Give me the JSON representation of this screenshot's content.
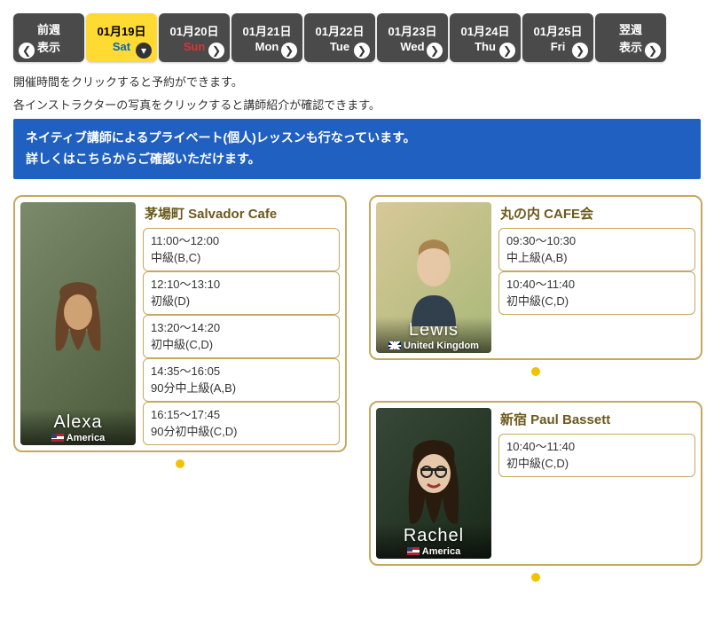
{
  "nav": {
    "prev": {
      "line1": "前週",
      "line2": "表示"
    },
    "next": {
      "line1": "翌週",
      "line2": "表示"
    },
    "dates": [
      {
        "date": "01月19日",
        "dow": "Sat",
        "selected": true,
        "sun": false
      },
      {
        "date": "01月20日",
        "dow": "Sun",
        "selected": false,
        "sun": true
      },
      {
        "date": "01月21日",
        "dow": "Mon",
        "selected": false,
        "sun": false
      },
      {
        "date": "01月22日",
        "dow": "Tue",
        "selected": false,
        "sun": false
      },
      {
        "date": "01月23日",
        "dow": "Wed",
        "selected": false,
        "sun": false
      },
      {
        "date": "01月24日",
        "dow": "Thu",
        "selected": false,
        "sun": false
      },
      {
        "date": "01月25日",
        "dow": "Fri",
        "selected": false,
        "sun": false
      }
    ]
  },
  "note1": "開催時間をクリックすると予約ができます。",
  "note2": "各インストラクターの写真をクリックすると講師紹介が確認できます。",
  "banner1": "ネイティブ講師によるプライベート(個人)レッスンも行なっています。",
  "banner2": "詳しくはこちらからご確認いただけます。",
  "cards": {
    "alexa": {
      "name": "Alexa",
      "country": "America",
      "flag": "us",
      "location": "茅場町 Salvador Cafe",
      "slots": [
        {
          "time": "11:00～12:00",
          "level": "中級(B,C)"
        },
        {
          "time": "12:10～13:10",
          "level": "初級(D)"
        },
        {
          "time": "13:20～14:20",
          "level": "初中級(C,D)"
        },
        {
          "time": "14:35～16:05",
          "level": "90分中上級(A,B)"
        },
        {
          "time": "16:15～17:45",
          "level": "90分初中級(C,D)"
        }
      ]
    },
    "lewis": {
      "name": "Lewis",
      "country": "United Kingdom",
      "flag": "uk",
      "location": "丸の内 CAFE会",
      "slots": [
        {
          "time": "09:30～10:30",
          "level": "中上級(A,B)"
        },
        {
          "time": "10:40～11:40",
          "level": "初中級(C,D)"
        }
      ]
    },
    "rachel": {
      "name": "Rachel",
      "country": "America",
      "flag": "us",
      "location": "新宿 Paul Bassett",
      "slots": [
        {
          "time": "10:40～11:40",
          "level": "初中級(C,D)"
        }
      ]
    }
  }
}
